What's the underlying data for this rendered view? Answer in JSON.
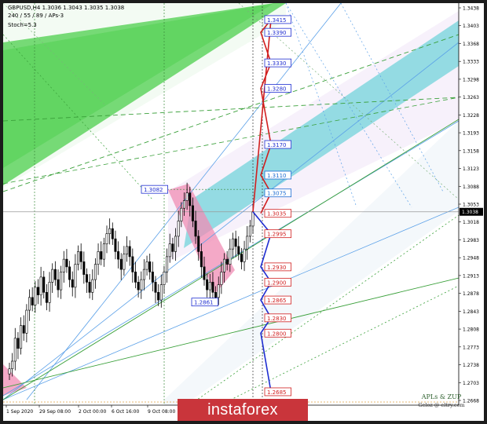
{
  "header": {
    "symbol_line": "GBPUSD,H4  1.3036 1.3043 1.3035 1.3038",
    "indicator_line": "240 / 55 / 89 / APs-3",
    "stoch_line": "Stoch=5.3"
  },
  "brand": {
    "text": "instaforex"
  },
  "watermark": {
    "title": "APLs & ZUP",
    "subtitle": "Geloz @ eltry.com"
  },
  "colors": {
    "up_target": "#d11f1f",
    "down_target": "#1f2ed1",
    "channel_fill": "#5fcfd6",
    "green_zone": "#5fd35f",
    "pink_zone": "#f08cb4"
  },
  "chart_data": {
    "type": "candlestick",
    "ylim": [
      1.2668,
      1.3438
    ],
    "current_price": 1.3038,
    "y_ticks": [
      "1.3438",
      "1.3403",
      "1.3368",
      "1.3333",
      "1.3298",
      "1.3263",
      "1.3228",
      "1.3193",
      "1.3158",
      "1.3123",
      "1.3088",
      "1.3053",
      "1.3018",
      "1.2983",
      "1.2948",
      "1.2913",
      "1.2878",
      "1.2843",
      "1.2808",
      "1.2773",
      "1.2738",
      "1.2703",
      "1.2668"
    ],
    "x_ticks": [
      "1 Sep 2020",
      "29 Sep 08:00",
      "2 Oct 00:00",
      "6 Oct 16:00",
      "9 Oct 08:00"
    ],
    "up_targets": [
      {
        "label": "1.3415",
        "value": 1.3415
      },
      {
        "label": "1.3390",
        "value": 1.339
      },
      {
        "label": "1.3330",
        "value": 1.333
      },
      {
        "label": "1.3280",
        "value": 1.328
      },
      {
        "label": "1.3170",
        "value": 1.317
      },
      {
        "label": "1.3110",
        "value": 1.311
      },
      {
        "label": "1.3075",
        "value": 1.3075
      },
      {
        "label": "1.3035",
        "value": 1.3035
      }
    ],
    "down_targets": [
      {
        "label": "1.2995",
        "value": 1.2995
      },
      {
        "label": "1.2930",
        "value": 1.293
      },
      {
        "label": "1.2900",
        "value": 1.29
      },
      {
        "label": "1.2865",
        "value": 1.2865
      },
      {
        "label": "1.2830",
        "value": 1.283
      },
      {
        "label": "1.2800",
        "value": 1.28
      },
      {
        "label": "1.2685",
        "value": 1.2685
      }
    ],
    "swing_labels": [
      {
        "label": "1.3082",
        "value": 1.3082
      },
      {
        "label": "1.2861",
        "value": 1.2861
      }
    ],
    "candle_closes": [
      1.273,
      1.2745,
      1.279,
      1.277,
      1.2815,
      1.28,
      1.2845,
      1.287,
      1.2855,
      1.289,
      1.2875,
      1.291,
      1.288,
      1.286,
      1.29,
      1.2925,
      1.2905,
      1.2885,
      1.292,
      1.2945,
      1.293,
      1.2905,
      1.289,
      1.2935,
      1.296,
      1.294,
      1.2915,
      1.29,
      1.288,
      1.2905,
      1.2935,
      1.296,
      1.2945,
      1.2975,
      1.2995,
      1.3005,
      1.2985,
      1.296,
      1.2945,
      1.2925,
      1.2955,
      1.297,
      1.295,
      1.292,
      1.29,
      1.2885,
      1.2905,
      1.2925,
      1.294,
      1.292,
      1.29,
      1.288,
      1.2865,
      1.2895,
      1.292,
      1.295,
      1.2975,
      1.296,
      1.299,
      1.302,
      1.3045,
      1.306,
      1.3075,
      1.305,
      1.302,
      1.299,
      1.296,
      1.293,
      1.2905,
      1.2885,
      1.29,
      1.288,
      1.287,
      1.2895,
      1.292,
      1.2945,
      1.2935,
      1.2965,
      1.2985,
      1.297,
      1.2955,
      1.294,
      1.2965,
      1.299,
      1.301,
      1.3038
    ]
  }
}
